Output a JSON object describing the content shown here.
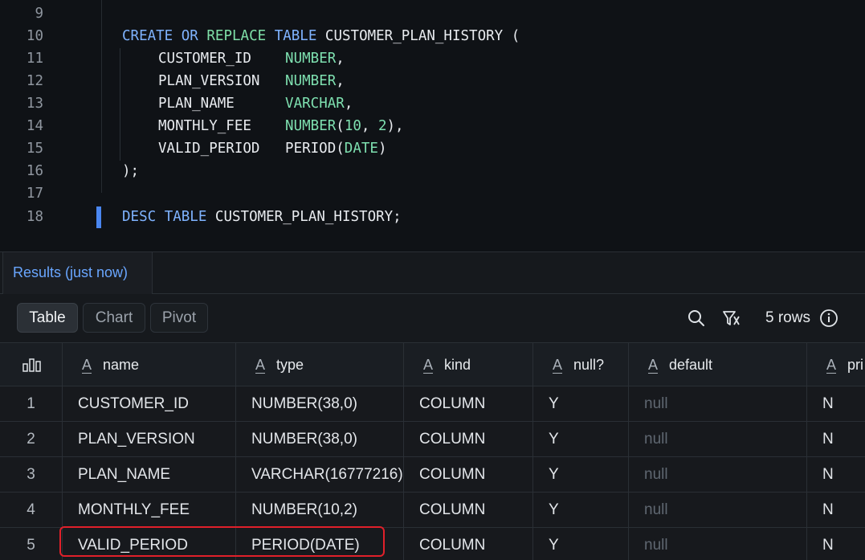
{
  "editor": {
    "lines": [
      {
        "num": "9",
        "tokens": []
      },
      {
        "num": "10",
        "tokens": [
          {
            "t": "CREATE",
            "c": "kw"
          },
          {
            "t": " ",
            "c": "plain"
          },
          {
            "t": "OR",
            "c": "kw"
          },
          {
            "t": " ",
            "c": "plain"
          },
          {
            "t": "REPLACE",
            "c": "fn"
          },
          {
            "t": " ",
            "c": "plain"
          },
          {
            "t": "TABLE",
            "c": "kw"
          },
          {
            "t": " CUSTOMER_PLAN_HISTORY (",
            "c": "plain"
          }
        ]
      },
      {
        "num": "11",
        "indent": true,
        "tokens": [
          {
            "t": "CUSTOMER_ID    ",
            "c": "plain"
          },
          {
            "t": "NUMBER",
            "c": "ty"
          },
          {
            "t": ",",
            "c": "plain"
          }
        ]
      },
      {
        "num": "12",
        "indent": true,
        "tokens": [
          {
            "t": "PLAN_VERSION   ",
            "c": "plain"
          },
          {
            "t": "NUMBER",
            "c": "ty"
          },
          {
            "t": ",",
            "c": "plain"
          }
        ]
      },
      {
        "num": "13",
        "indent": true,
        "tokens": [
          {
            "t": "PLAN_NAME      ",
            "c": "plain"
          },
          {
            "t": "VARCHAR",
            "c": "ty"
          },
          {
            "t": ",",
            "c": "plain"
          }
        ]
      },
      {
        "num": "14",
        "indent": true,
        "tokens": [
          {
            "t": "MONTHLY_FEE    ",
            "c": "plain"
          },
          {
            "t": "NUMBER",
            "c": "ty"
          },
          {
            "t": "(",
            "c": "plain"
          },
          {
            "t": "10",
            "c": "num"
          },
          {
            "t": ", ",
            "c": "plain"
          },
          {
            "t": "2",
            "c": "num"
          },
          {
            "t": "),",
            "c": "plain"
          }
        ]
      },
      {
        "num": "15",
        "indent": true,
        "tokens": [
          {
            "t": "VALID_PERIOD   PERIOD(",
            "c": "plain"
          },
          {
            "t": "DATE",
            "c": "ty"
          },
          {
            "t": ")",
            "c": "plain"
          }
        ]
      },
      {
        "num": "16",
        "tokens": [
          {
            "t": ");",
            "c": "plain"
          }
        ]
      },
      {
        "num": "17",
        "tokens": []
      },
      {
        "num": "18",
        "tokens": [
          {
            "t": "DESC",
            "c": "kw"
          },
          {
            "t": " ",
            "c": "plain"
          },
          {
            "t": "TABLE",
            "c": "kw"
          },
          {
            "t": " CUSTOMER_PLAN_HISTORY;",
            "c": "plain"
          }
        ]
      }
    ]
  },
  "results": {
    "tab_label": "Results (just now)",
    "view_buttons": [
      "Table",
      "Chart",
      "Pivot"
    ],
    "active_view": "Table",
    "row_count": "5 rows",
    "icons": {
      "search": "search-icon",
      "filter": "filter-icon",
      "info": "info-icon",
      "columns": "column-chart-icon",
      "text_type": "text-type-icon"
    }
  },
  "table": {
    "columns": [
      "name",
      "type",
      "kind",
      "null?",
      "default",
      "pri"
    ],
    "rows": [
      {
        "n": "1",
        "name": "CUSTOMER_ID",
        "type": "NUMBER(38,0)",
        "kind": "COLUMN",
        "null": "Y",
        "default": "null",
        "pri": "N"
      },
      {
        "n": "2",
        "name": "PLAN_VERSION",
        "type": "NUMBER(38,0)",
        "kind": "COLUMN",
        "null": "Y",
        "default": "null",
        "pri": "N"
      },
      {
        "n": "3",
        "name": "PLAN_NAME",
        "type": "VARCHAR(16777216)",
        "kind": "COLUMN",
        "null": "Y",
        "default": "null",
        "pri": "N"
      },
      {
        "n": "4",
        "name": "MONTHLY_FEE",
        "type": "NUMBER(10,2)",
        "kind": "COLUMN",
        "null": "Y",
        "default": "null",
        "pri": "N"
      },
      {
        "n": "5",
        "name": "VALID_PERIOD",
        "type": "PERIOD(DATE)",
        "kind": "COLUMN",
        "null": "Y",
        "default": "null",
        "pri": "N"
      }
    ]
  }
}
